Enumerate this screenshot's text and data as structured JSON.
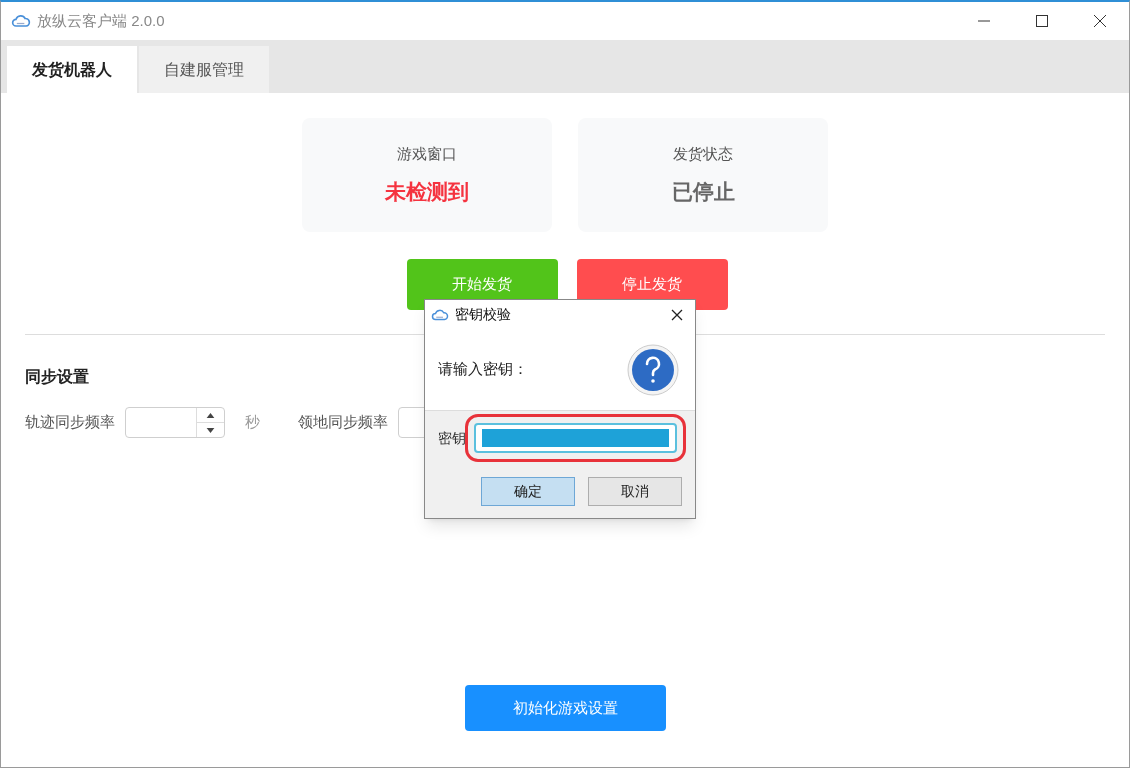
{
  "window": {
    "title": "放纵云客户端 2.0.0"
  },
  "tabs": [
    {
      "label": "发货机器人",
      "selected": true
    },
    {
      "label": "自建服管理",
      "selected": false
    }
  ],
  "status_cards": [
    {
      "label": "游戏窗口",
      "value": "未检测到",
      "kind": "alert"
    },
    {
      "label": "发货状态",
      "value": "已停止",
      "kind": "neutral"
    }
  ],
  "actions": [
    {
      "label": "开始发货",
      "kind": "start"
    },
    {
      "label": "停止发货",
      "kind": "stop"
    }
  ],
  "sync_settings": {
    "title": "同步设置",
    "fields": [
      {
        "label": "轨迹同步频率",
        "unit": "秒"
      },
      {
        "label": "领地同步频率"
      }
    ]
  },
  "init_button": "初始化游戏设置",
  "dialog": {
    "title": "密钥校验",
    "prompt": "请输入密钥：",
    "field_label": "密钥",
    "highlighted": true,
    "buttons": [
      {
        "label": "确定",
        "kind": "default"
      },
      {
        "label": "取消",
        "kind": "normal"
      }
    ]
  }
}
